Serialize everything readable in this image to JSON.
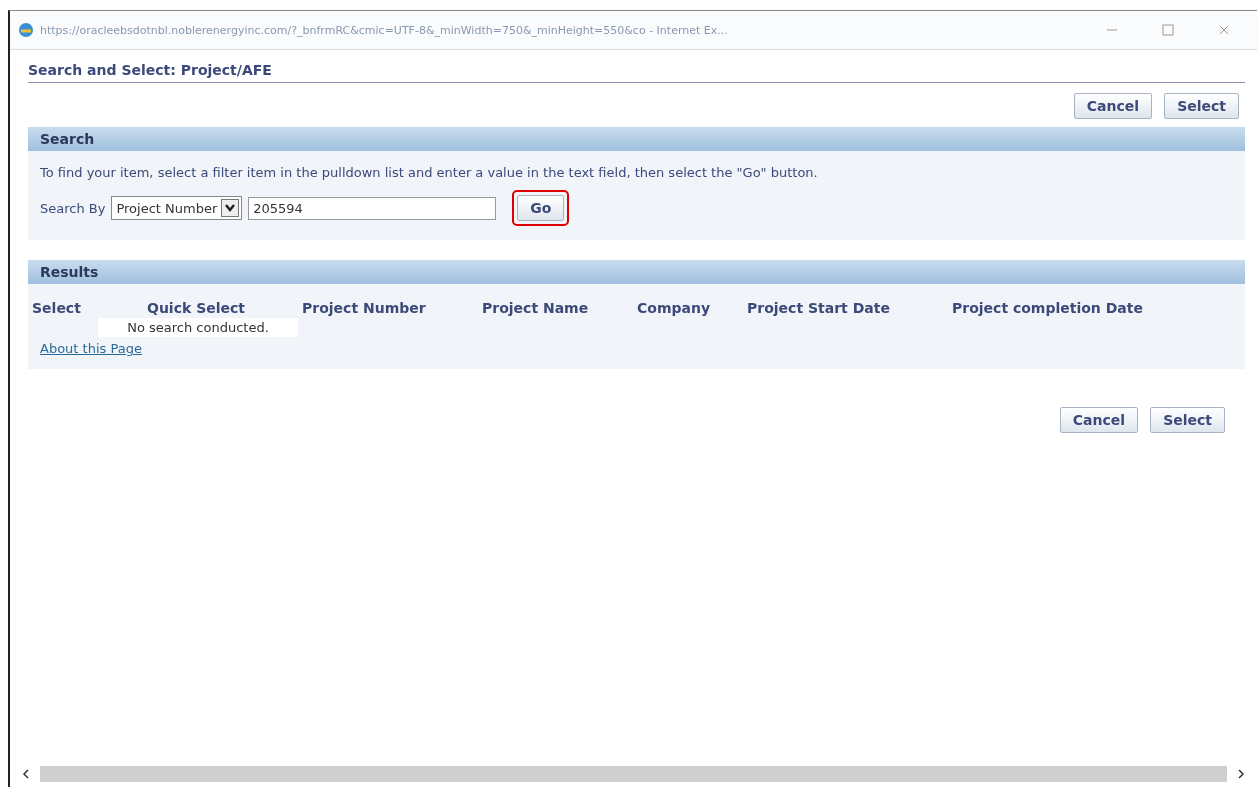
{
  "window": {
    "address": "https://oracleebsdotnbl.noblerenergyinc.com/?_bnfrmRC&cmic=UTF-8&_minWidth=750&_minHeight=550&co - Internet Ex..."
  },
  "page": {
    "title": "Search and Select: Project/AFE"
  },
  "top_buttons": [
    "Cancel",
    "Select"
  ],
  "search": {
    "header": "Search",
    "instructions": "To find your item, select a filter item in the pulldown list and enter a value in the text field, then select the \"Go\" button.",
    "label": "Search By",
    "filter": "Project Number",
    "value": "205594",
    "go": "Go",
    "go_highlighted": true
  },
  "results": {
    "header": "Results",
    "columns": [
      "Select",
      "Quick Select",
      "Project Number",
      "Project Name",
      "Company",
      "Project Start Date",
      "Project completion Date"
    ],
    "empty_message": "No search conducted.",
    "link": "About this Page"
  },
  "bottom_buttons": [
    "Cancel",
    "Select"
  ]
}
